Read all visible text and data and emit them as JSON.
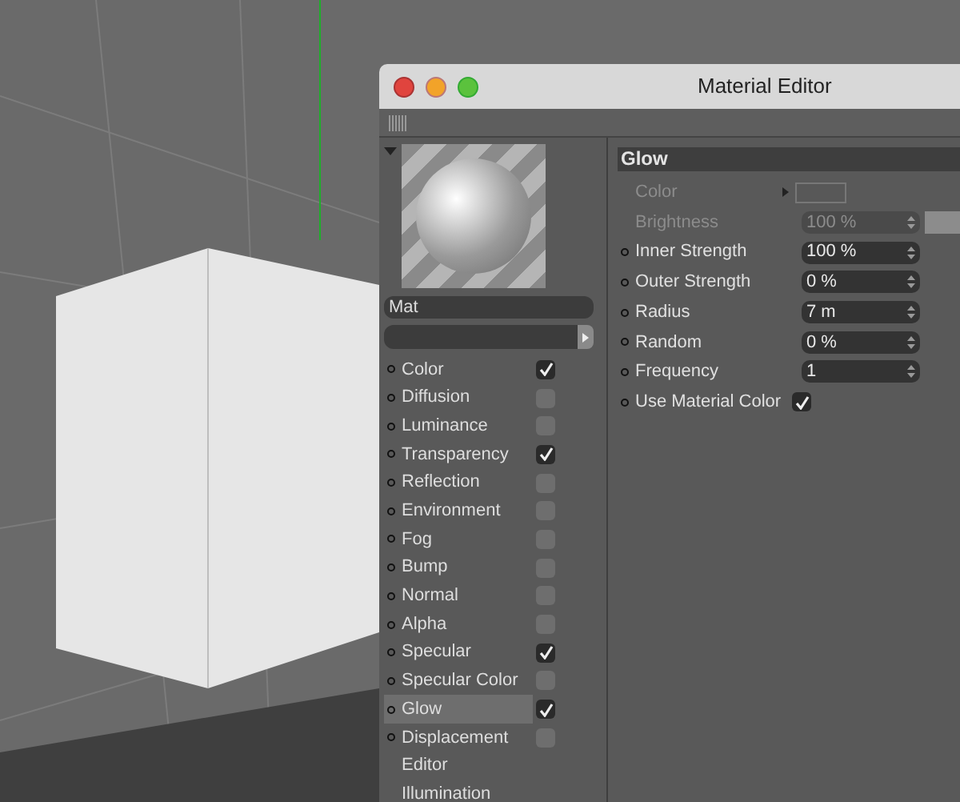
{
  "window": {
    "title": "Material Editor"
  },
  "material": {
    "name": "Mat"
  },
  "channels": [
    {
      "label": "Color",
      "kind": "check",
      "checked": true,
      "selected": false
    },
    {
      "label": "Diffusion",
      "kind": "check",
      "checked": false,
      "selected": false
    },
    {
      "label": "Luminance",
      "kind": "check",
      "checked": false,
      "selected": false
    },
    {
      "label": "Transparency",
      "kind": "check",
      "checked": true,
      "selected": false
    },
    {
      "label": "Reflection",
      "kind": "check",
      "checked": false,
      "selected": false
    },
    {
      "label": "Environment",
      "kind": "check",
      "checked": false,
      "selected": false
    },
    {
      "label": "Fog",
      "kind": "check",
      "checked": false,
      "selected": false
    },
    {
      "label": "Bump",
      "kind": "check",
      "checked": false,
      "selected": false
    },
    {
      "label": "Normal",
      "kind": "check",
      "checked": false,
      "selected": false
    },
    {
      "label": "Alpha",
      "kind": "check",
      "checked": false,
      "selected": false
    },
    {
      "label": "Specular",
      "kind": "check",
      "checked": true,
      "selected": false
    },
    {
      "label": "Specular Color",
      "kind": "check",
      "checked": false,
      "selected": false
    },
    {
      "label": "Glow",
      "kind": "check",
      "checked": true,
      "selected": true
    },
    {
      "label": "Displacement",
      "kind": "check",
      "checked": false,
      "selected": false
    },
    {
      "label": "Editor",
      "kind": "plain",
      "selected": false
    },
    {
      "label": "Illumination",
      "kind": "plain",
      "selected": false
    }
  ],
  "section": {
    "title": "Glow"
  },
  "properties": [
    {
      "label": "Color",
      "kind": "color",
      "disabled": true
    },
    {
      "label": "Brightness",
      "kind": "number",
      "value": "100 %",
      "disabled": true,
      "level": 1
    },
    {
      "label": "Inner Strength",
      "kind": "number",
      "value": "100 %",
      "disabled": false
    },
    {
      "label": "Outer Strength",
      "kind": "number",
      "value": "0 %",
      "disabled": false
    },
    {
      "label": "Radius",
      "kind": "number",
      "value": "7 m",
      "disabled": false
    },
    {
      "label": "Random",
      "kind": "number",
      "value": "0 %",
      "disabled": false
    },
    {
      "label": "Frequency",
      "kind": "number",
      "value": "1",
      "disabled": false
    },
    {
      "label": "Use Material Color",
      "kind": "check",
      "checked": true,
      "disabled": false
    }
  ]
}
